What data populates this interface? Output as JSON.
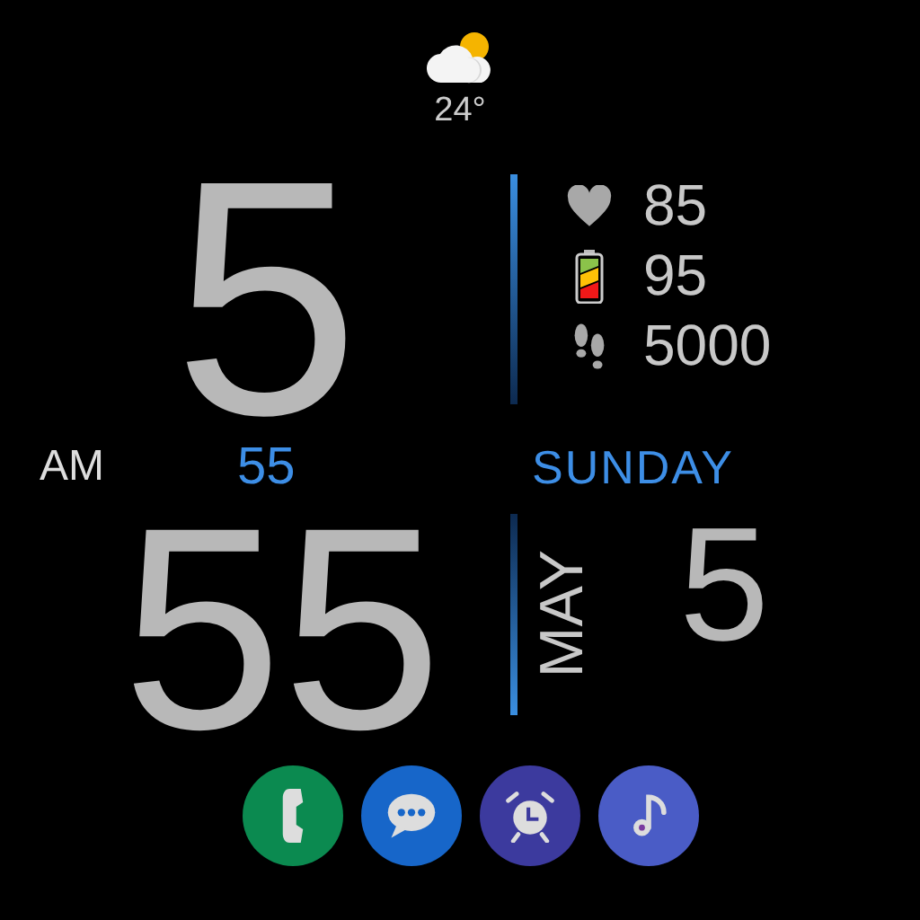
{
  "weather": {
    "kind": "partly_cloudy",
    "temperature": "24°"
  },
  "time": {
    "hour": "5",
    "period": "AM",
    "seconds": "55",
    "minute": "55"
  },
  "stats": [
    {
      "kind": "heart",
      "value": "85"
    },
    {
      "kind": "battery",
      "value": "95"
    },
    {
      "kind": "steps",
      "value": "5000"
    }
  ],
  "date": {
    "weekday": "SUNDAY",
    "month": "MAY",
    "day": "5"
  },
  "apps": [
    {
      "kind": "phone",
      "color": "#0b8a50"
    },
    {
      "kind": "messages",
      "color": "#1766c9"
    },
    {
      "kind": "alarm",
      "color": "#3c3a9e"
    },
    {
      "kind": "music",
      "color": "#4a5cc6"
    }
  ]
}
